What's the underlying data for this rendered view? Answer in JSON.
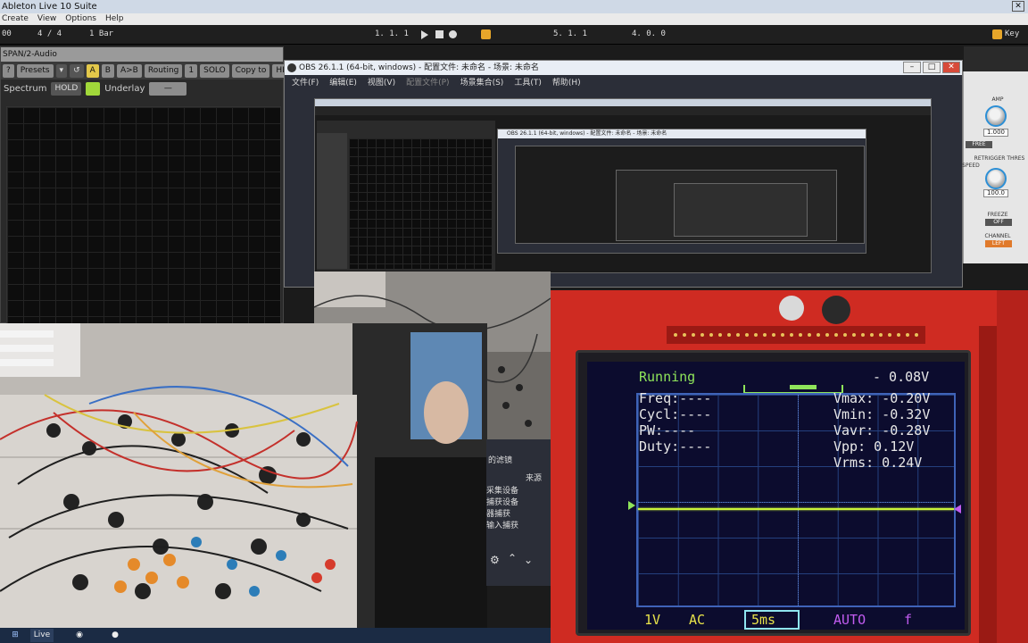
{
  "ableton": {
    "title": "Ableton Live 10 Suite",
    "menu": [
      "Create",
      "View",
      "Options",
      "Help"
    ],
    "transport": {
      "tempo": "00",
      "signature": "4 / 4",
      "loop_button": "1 Bar",
      "arrangement_position": "1.  1.  1",
      "loop_start": "5.  1.  1",
      "loop_length": "4.  0.  0",
      "key_label": "Key"
    }
  },
  "span": {
    "title": "SPAN/2-Audio",
    "toolbar": {
      "help": "?",
      "presets": "Presets",
      "a": "A",
      "b": "B",
      "ab": "A>B",
      "routing": "Routing",
      "one": "1",
      "solo": "SOLO",
      "copy_to": "Copy to",
      "hide": "HIDE"
    },
    "spectrum_label": "Spectrum",
    "hold": "HOLD",
    "underlay": "Underlay",
    "underlay_value": "—"
  },
  "obs": {
    "title": "OBS 26.1.1 (64-bit, windows) - 配置文件: 未命名 - 场景: 未命名",
    "menu": [
      "文件(F)",
      "编辑(E)",
      "视图(V)",
      "配置文件(P)",
      "场景集合(S)",
      "工具(T)",
      "帮助(H)"
    ],
    "nested_title": "OBS 26.1.1 (64-bit, windows) - 配置文件: 未命名 - 场景: 未命名",
    "lower_panel": {
      "tab": "的滤镜",
      "header": "来源",
      "sources": [
        "采集设备",
        "捕获设备",
        "器捕获",
        "输入捕获"
      ]
    }
  },
  "device_panel": {
    "amp": "AMP",
    "amp_value": "1.000",
    "free": "FREE",
    "retrigger_thres": "RETRIGGER THRES",
    "retrigger_value": "100.0",
    "speed": "SPEED",
    "freeze": "FREEZE",
    "freeze_value": "OFF",
    "channel": "CHANNEL",
    "channel_value": "LEFT"
  },
  "scope": {
    "status": "Running",
    "offset": "- 0.08V",
    "freq_label": "Freq:----",
    "cycl_label": "Cycl:----",
    "pw_label": "PW:----",
    "duty_label": "Duty:----",
    "vmax": "Vmax: -0.20V",
    "vmin": "Vmin: -0.32V",
    "vavr": "Vavr: -0.28V",
    "vpp": "Vpp:  0.12V",
    "vrms": "Vrms: 0.24V",
    "volts_div": "1V",
    "coupling": "AC",
    "timebase": "5ms",
    "trigger_mode": "AUTO",
    "trigger_edge": "f"
  },
  "taskbar": {
    "live": "Live"
  },
  "colors": {
    "trace": "#c9f23a",
    "scope_text": "#8fe55a",
    "pcb_red": "#cf2b22",
    "hold_green": "#a1d83a"
  }
}
